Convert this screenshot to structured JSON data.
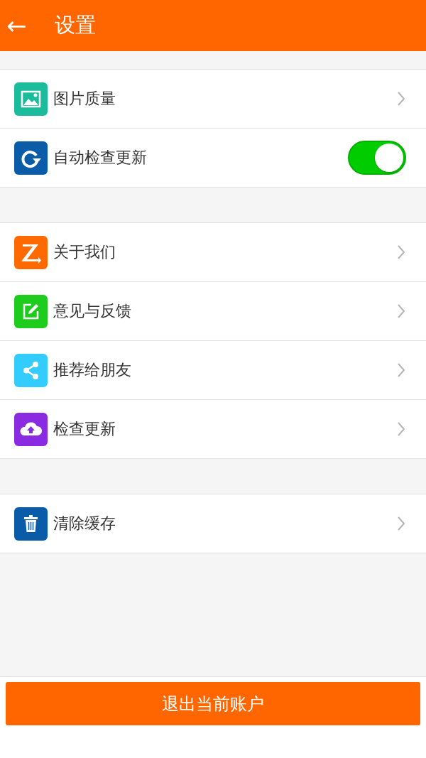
{
  "header": {
    "back": "←",
    "title": "设置"
  },
  "groups": [
    {
      "items": [
        {
          "kind": "link",
          "label": "图片质量",
          "color": "#1abc9c"
        },
        {
          "kind": "toggle",
          "label": "自动检查更新",
          "color": "#0a5ca8",
          "on": true
        }
      ]
    },
    {
      "items": [
        {
          "kind": "link",
          "label": "关于我们",
          "color": "#ff6a00"
        },
        {
          "kind": "link",
          "label": "意见与反馈",
          "color": "#1dcc1d"
        },
        {
          "kind": "link",
          "label": "推荐给朋友",
          "color": "#33ccff"
        },
        {
          "kind": "link",
          "label": "检查更新",
          "color": "#8a2be2"
        }
      ]
    },
    {
      "items": [
        {
          "kind": "link",
          "label": "清除缓存",
          "color": "#0a5ca8"
        }
      ]
    }
  ],
  "logout_button": "退出当前账户"
}
